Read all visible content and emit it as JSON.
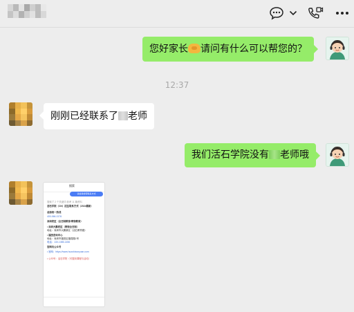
{
  "header": {
    "icons": {
      "chat": "chat-bubble-icon",
      "chevron": "chevron-down-icon",
      "call": "phone-video-icon",
      "more": "more-icon"
    }
  },
  "colors": {
    "background": "#ededed",
    "self_bubble": "#95ec69",
    "other_bubble": "#ffffff",
    "timestamp": "#a8a8a8"
  },
  "messages": [
    {
      "from": "self",
      "text_before": "您好家长",
      "emoji": "handshake-emoji",
      "text_after": "请问有什么可以帮您的？"
    },
    {
      "type": "timestamp",
      "text": "12:37"
    },
    {
      "from": "other",
      "text_before": "刚刚已经联系了",
      "text_after": "老师"
    },
    {
      "from": "self",
      "text_before": "我们活石学院没有",
      "text_after": "老师哦"
    },
    {
      "from": "other",
      "type": "image",
      "content": {
        "title": "搜索",
        "pill": "请给我搜索联系方式",
        "lines": [
          "搜索了 2 个关键词    参考 11 篇资料",
          "活石学院（CN）招生联系方式（2024最新）",
          "总部统一热线",
          "400-066-0176",
          "深圳校区（全日制教育/寄宿教育）",
          "• 深圳大鹏校区（寄宿全日制）",
          "  地址：深圳市大鹏新区（活石教育路）",
          "• 福田咨询中心",
          "  地址：深圳市福田区福强路1号",
          "  电话：130-1385-1456",
          "官网与公众号",
          "• 官网：https://www.huoshixueyuan.com",
          "• 公众号：活石学院（可搜到课程与活动）"
        ]
      }
    }
  ]
}
